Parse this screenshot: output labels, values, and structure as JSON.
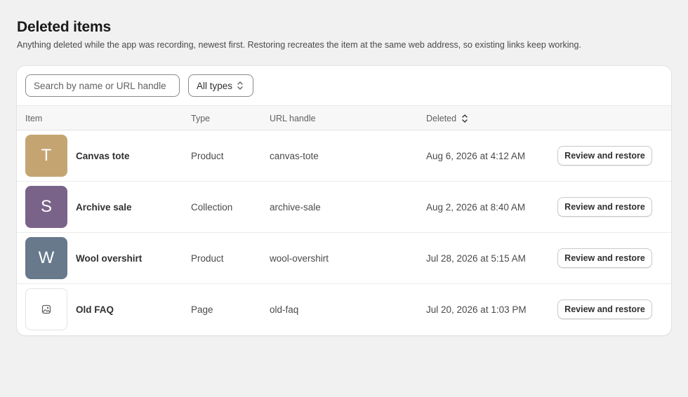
{
  "page": {
    "title": "Deleted items",
    "subtitle": "Anything deleted while the app was recording, newest first. Restoring recreates the item at the same web address, so existing links keep working."
  },
  "toolbar": {
    "search_placeholder": "Search by name or URL handle",
    "search_value": "",
    "type_filter_label": "All types"
  },
  "table": {
    "columns": {
      "item": "Item",
      "type": "Type",
      "handle": "URL handle",
      "deleted": "Deleted"
    },
    "sort": {
      "column": "Deleted",
      "direction": "descending"
    },
    "rows": [
      {
        "initial": "T",
        "thumb_color": "#c4a572",
        "name": "Canvas tote",
        "type": "Product",
        "handle": "canvas-tote",
        "deleted": "Aug 6, 2026 at 4:12 AM",
        "action": "Review and restore"
      },
      {
        "initial": "S",
        "thumb_color": "#7a6388",
        "name": "Archive sale",
        "type": "Collection",
        "handle": "archive-sale",
        "deleted": "Aug 2, 2026 at 8:40 AM",
        "action": "Review and restore"
      },
      {
        "initial": "W",
        "thumb_color": "#67798b",
        "name": "Wool overshirt",
        "type": "Product",
        "handle": "wool-overshirt",
        "deleted": "Jul 28, 2026 at 5:15 AM",
        "action": "Review and restore"
      },
      {
        "initial": "",
        "thumb_icon": "image-placeholder-icon",
        "name": "Old FAQ",
        "type": "Page",
        "handle": "old-faq",
        "deleted": "Jul 20, 2026 at 1:03 PM",
        "action": "Review and restore"
      }
    ]
  }
}
